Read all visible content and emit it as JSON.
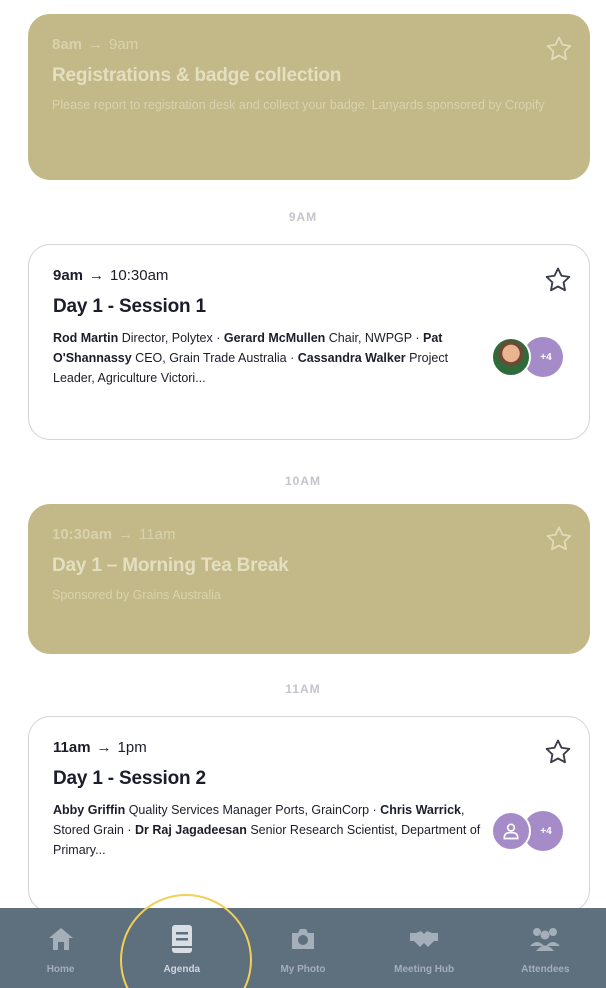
{
  "colors": {
    "past_card": "#c2b888",
    "tabbar": "#5e6f7e",
    "avatar": "#a58cc9",
    "highlight": "#f3cf55"
  },
  "sessions": [
    {
      "start": "8am",
      "arrow": "→",
      "end": "9am",
      "title": "Registrations & badge collection",
      "description": "Please report to registration desk and collect your badge. Lanyards sponsored by Cropify",
      "favorite_icon": "star-outline-icon"
    },
    {
      "start": "9am",
      "arrow": "→",
      "end": "10:30am",
      "title": "Day 1 - Session 1",
      "speakers": [
        {
          "name": "Rod Martin",
          "role": " Director, Polytex"
        },
        {
          "name": "Gerard McMullen",
          "role": " Chair, NWPGP"
        },
        {
          "name": "Pat O'Shannassy",
          "role": " CEO, Grain Trade Australia"
        },
        {
          "name": "Cassandra Walker",
          "role": " Project Leader, Agriculture Victori..."
        }
      ],
      "extra_count": "+4",
      "favorite_icon": "star-outline-icon"
    },
    {
      "start": "10:30am",
      "arrow": "→",
      "end": "11am",
      "title": "Day 1 – Morning Tea Break",
      "description": "Sponsored by Grains Australia",
      "favorite_icon": "star-outline-icon"
    },
    {
      "start": "11am",
      "arrow": "→",
      "end": "1pm",
      "title": "Day 1 - Session 2",
      "speakers": [
        {
          "name": "Abby Griffin",
          "role": " Quality Services Manager Ports, GrainCorp"
        },
        {
          "name": "Chris Warrick",
          "role": ", Stored Grain"
        },
        {
          "name": "Dr Raj Jagadeesan",
          "role": " Senior Research Scientist, Department of Primary..."
        }
      ],
      "extra_count": "+4",
      "favorite_icon": "star-outline-icon"
    }
  ],
  "hour_markers": [
    "9AM",
    "10AM",
    "11AM"
  ],
  "separator": " · ",
  "tabs": [
    {
      "label": "Home",
      "icon": "home-icon"
    },
    {
      "label": "Agenda",
      "icon": "book-icon",
      "selected": true
    },
    {
      "label": "My Photo",
      "icon": "camera-icon"
    },
    {
      "label": "Meeting Hub",
      "icon": "handshake-icon"
    },
    {
      "label": "Attendees",
      "icon": "people-icon"
    }
  ]
}
